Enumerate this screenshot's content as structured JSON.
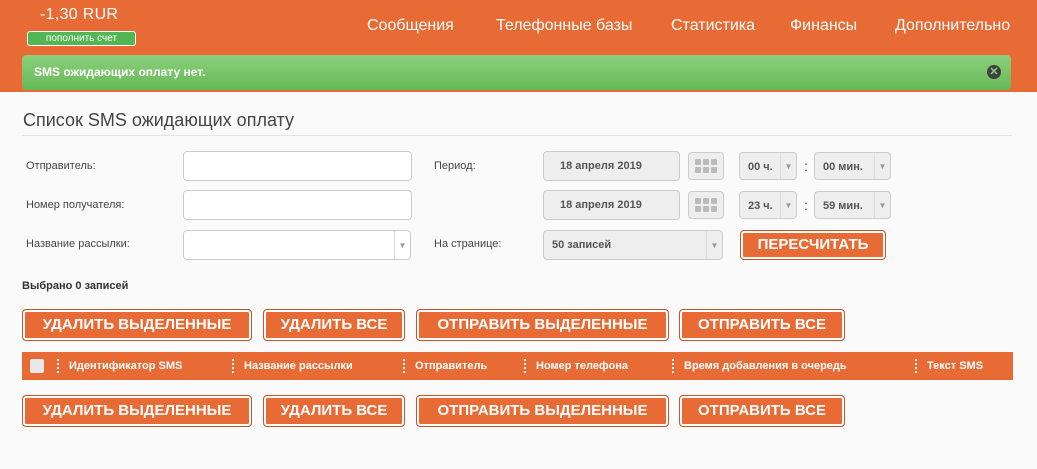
{
  "header": {
    "balance": "-1,30 RUR",
    "topup_label": "пополнить счет",
    "nav": [
      "Сообщения",
      "Телефонные базы",
      "Статистика",
      "Финансы",
      "Дополнительно"
    ]
  },
  "alert": {
    "text": "SMS ожидающих оплату нет."
  },
  "main": {
    "title": "Список SMS ожидающих оплату",
    "filters": {
      "sender_label": "Отправитель:",
      "recipient_label": "Номер получателя:",
      "mailing_label": "Название рассылки:",
      "period_label": "Период:",
      "per_page_label": "На странице:",
      "date_from": "18 апреля 2019",
      "date_to": "18 апреля 2019",
      "hour_from": "00 ч.",
      "min_from": "00 мин.",
      "hour_to": "23 ч.",
      "min_to": "59 мин.",
      "per_page": "50 записей",
      "recalc_label": "ПЕРЕСЧИТАТЬ"
    },
    "selected_count": "Выбрано 0 записей",
    "actions": {
      "delete_selected": "УДАЛИТЬ ВЫДЕЛЕННЫЕ",
      "delete_all": "УДАЛИТЬ ВСЕ",
      "send_selected": "ОТПРАВИТЬ ВЫДЕЛЕННЫЕ",
      "send_all": "ОТПРАВИТЬ ВСЕ"
    },
    "table": {
      "columns": [
        "Идентификатор SMS",
        "Название рассылки",
        "Отправитель",
        "Номер телефона",
        "Время добавления в очередь",
        "Текст SMS"
      ]
    }
  },
  "colors": {
    "accent": "#e86a34",
    "alert_green": "#66b958",
    "topup_green": "#53b553"
  }
}
